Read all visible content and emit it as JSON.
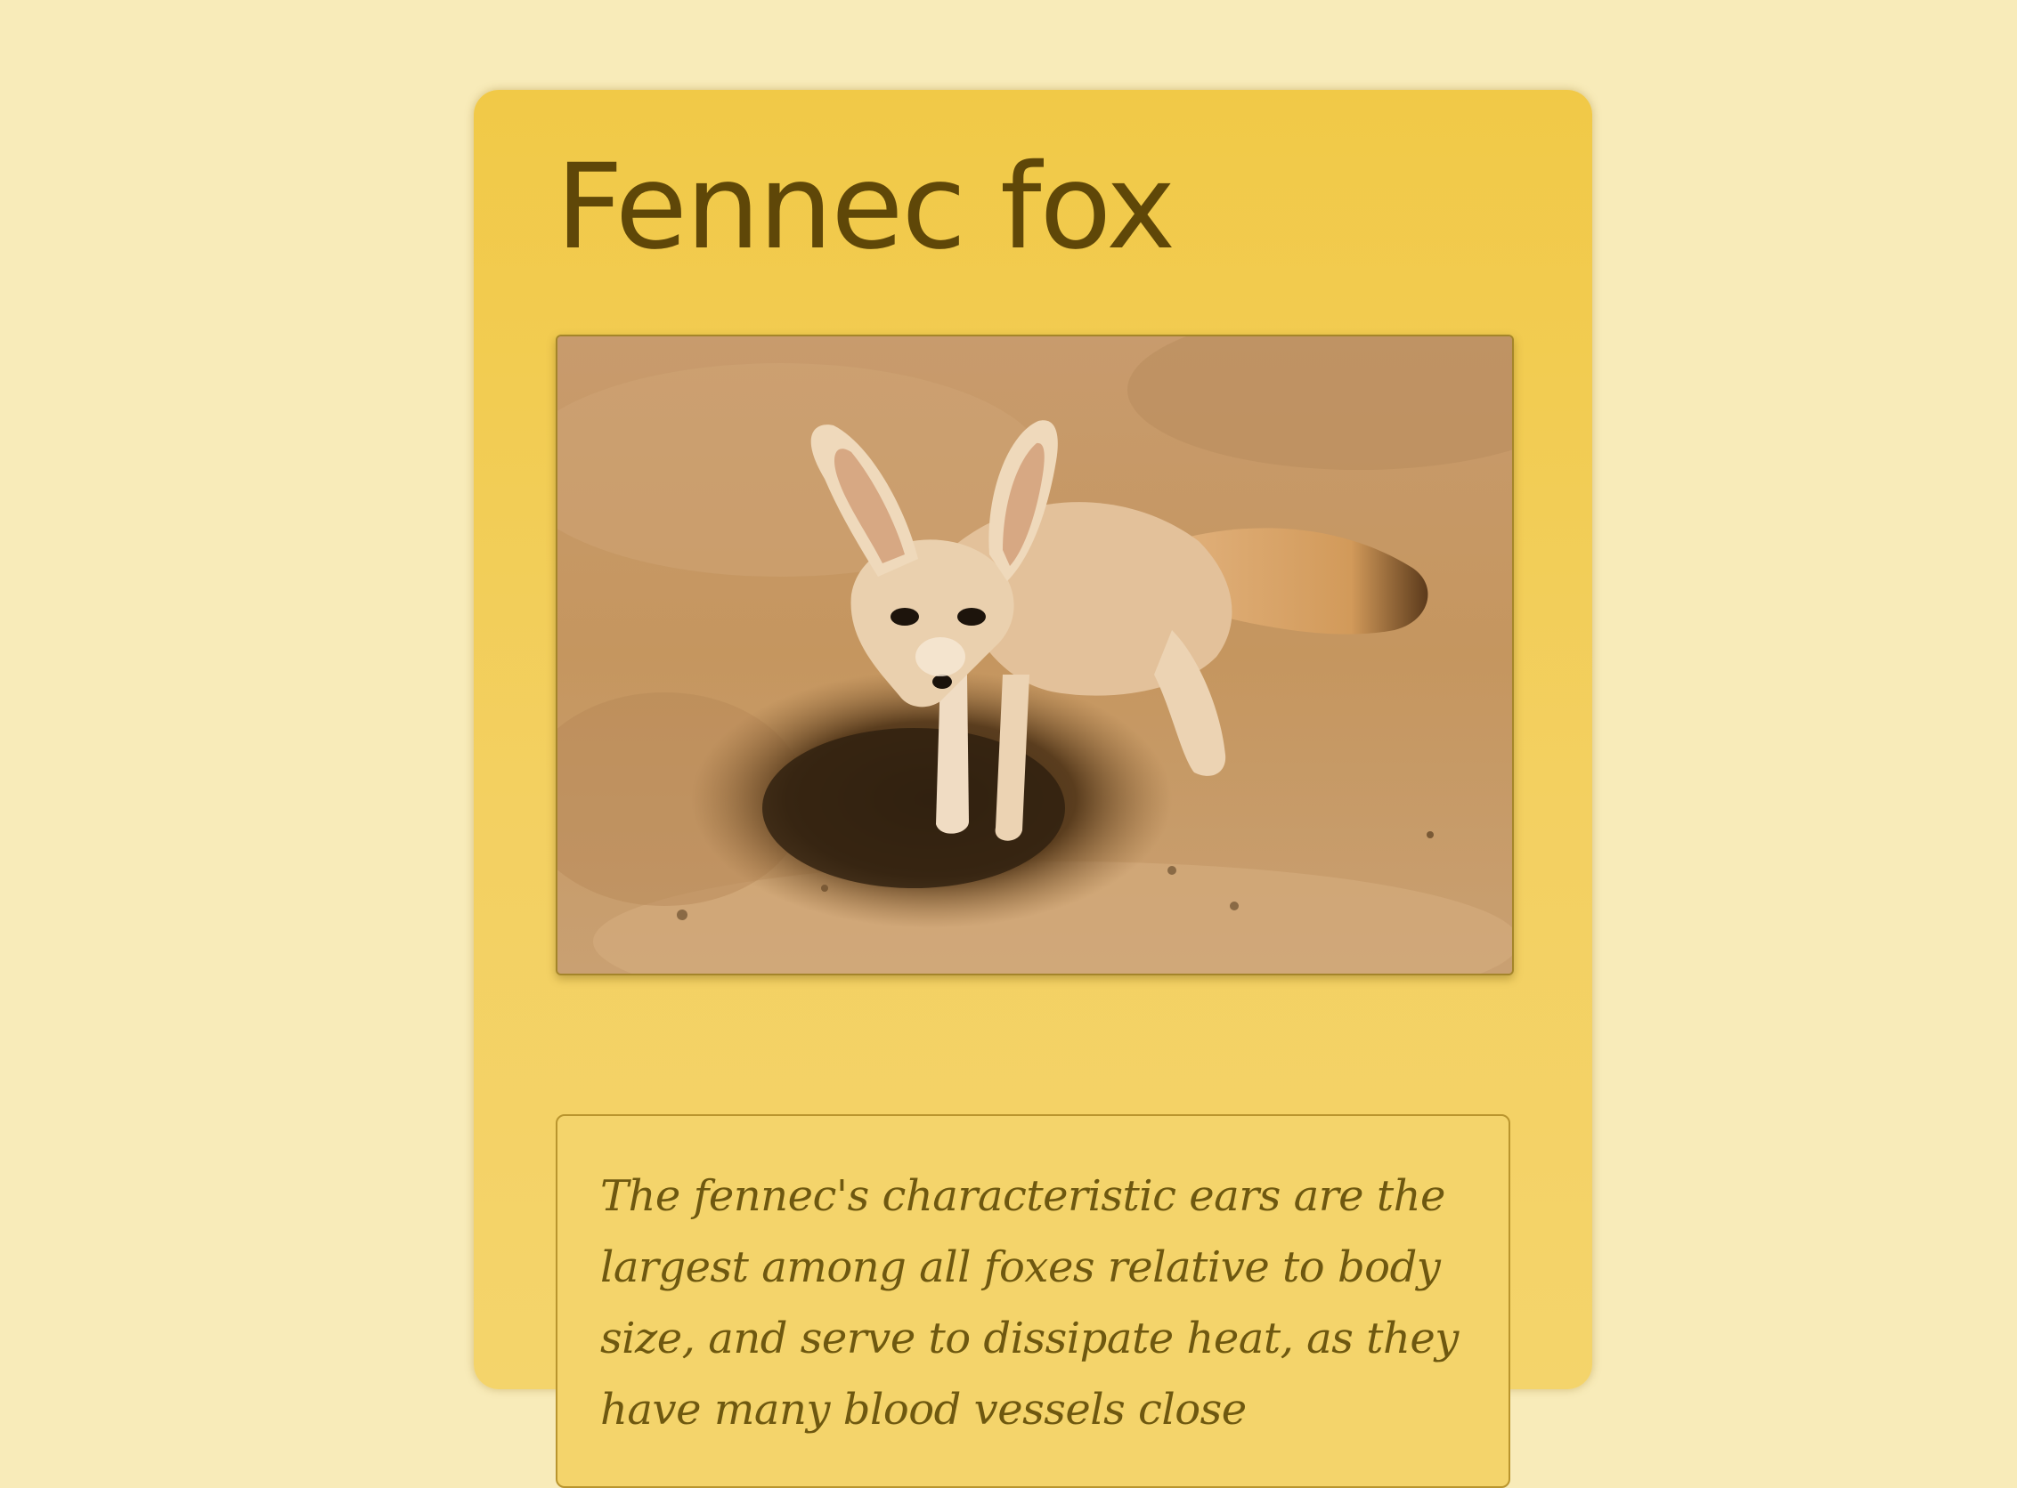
{
  "page": {
    "background_color": "#f8ebb9"
  },
  "card": {
    "title": "Fennec fox",
    "accent_color": "#f1c947",
    "title_color": "#5f4708",
    "image": {
      "subject": "fennec fox standing beside a burrow in sand"
    },
    "description": "The fennec's characteristic ears are the largest among all foxes relative to body size, and serve to dissipate heat, as they have many blood vessels close"
  }
}
